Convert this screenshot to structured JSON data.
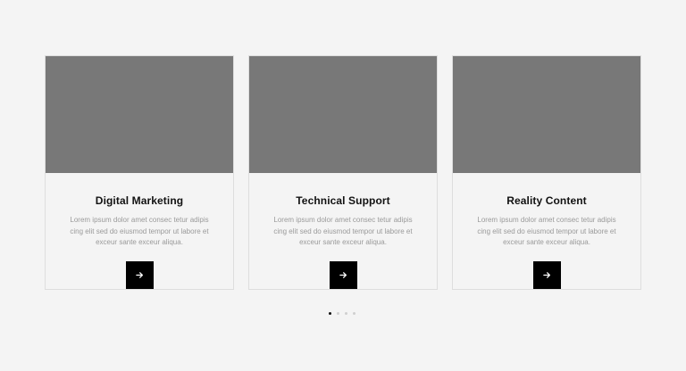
{
  "colors": {
    "background": "#f4f4f4",
    "image_placeholder": "#787878",
    "button": "#000000",
    "title": "#111111",
    "body_text": "#9a9a9a",
    "dot_active": "#111111",
    "dot_inactive": "#cfcfcf"
  },
  "cards": [
    {
      "title": "Digital Marketing",
      "text": "Lorem ipsum dolor amet consec tetur adipis cing elit sed do eiusmod tempor ut labore et exceur sante exceur aliqua.",
      "button_icon": "arrow-right-icon"
    },
    {
      "title": "Technical Support",
      "text": "Lorem ipsum dolor amet consec tetur adipis cing elit sed do eiusmod tempor ut labore et exceur sante exceur aliqua.",
      "button_icon": "arrow-right-icon"
    },
    {
      "title": "Reality Content",
      "text": "Lorem ipsum dolor amet consec tetur adipis cing elit sed do eiusmod tempor ut labore et exceur sante exceur aliqua.",
      "button_icon": "arrow-right-icon"
    }
  ],
  "pagination": {
    "count": 4,
    "active_index": 0
  }
}
